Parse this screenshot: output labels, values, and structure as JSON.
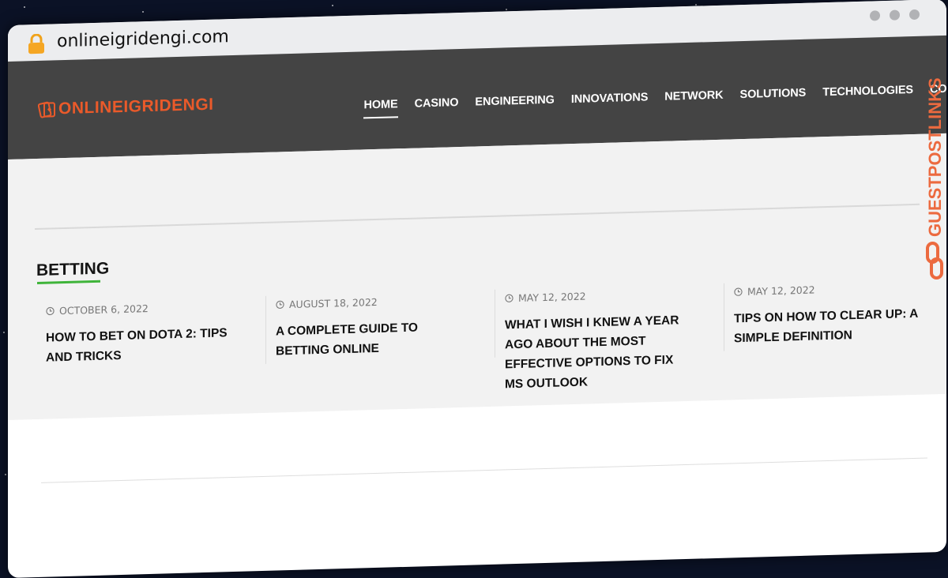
{
  "browser": {
    "url": "onlineigridengi.com"
  },
  "header": {
    "logo_text": "ONLINEIGRIDENGI",
    "nav": [
      {
        "label": "HOME",
        "active": true
      },
      {
        "label": "CASINO"
      },
      {
        "label": "ENGINEERING"
      },
      {
        "label": "INNOVATIONS"
      },
      {
        "label": "NETWORK"
      },
      {
        "label": "SOLUTIONS"
      },
      {
        "label": "TECHNOLOGIES"
      },
      {
        "label": "CONTACT"
      }
    ]
  },
  "section": {
    "title": "BETTING",
    "posts": [
      {
        "date": "OCTOBER 6, 2022",
        "title": "HOW TO BET ON DOTA 2: TIPS AND TRICKS"
      },
      {
        "date": "AUGUST 18, 2022",
        "title": "A COMPLETE GUIDE TO BETTING ONLINE"
      },
      {
        "date": "MAY 12, 2022",
        "title": "WHAT I WISH I KNEW A YEAR AGO ABOUT THE MOST EFFECTIVE OPTIONS TO FIX MS OUTLOOK"
      },
      {
        "date": "MAY 12, 2022",
        "title": "TIPS ON HOW TO CLEAR UP: A SIMPLE DEFINITION"
      }
    ]
  },
  "watermark": {
    "text": "GUESTPOSTLINKS"
  },
  "colors": {
    "accent": "#ea5a2a",
    "header_bg": "#444444",
    "underline": "#3fb43a",
    "watermark": "#ec6a3f"
  }
}
